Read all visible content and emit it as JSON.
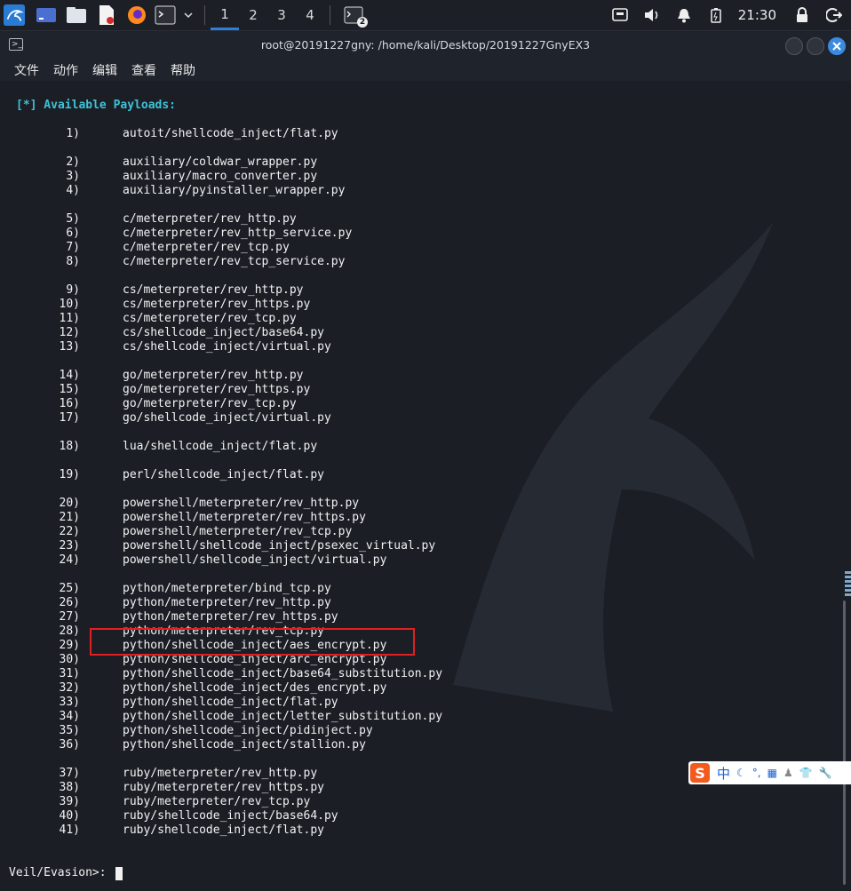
{
  "taskbar": {
    "workspaces": [
      "1",
      "2",
      "3",
      "4"
    ],
    "active_workspace": 0,
    "terminal_badge": "2",
    "clock": "21:30"
  },
  "window": {
    "title": "root@20191227gny: /home/kali/Desktop/20191227GnyEX3"
  },
  "menu": [
    "文件",
    "动作",
    "编辑",
    "查看",
    "帮助"
  ],
  "terminal": {
    "header": "[*] Available Payloads:",
    "payloads": [
      {
        "n": "1)",
        "p": "autoit/shellcode_inject/flat.py"
      },
      {
        "n": "2)",
        "p": "auxiliary/coldwar_wrapper.py"
      },
      {
        "n": "3)",
        "p": "auxiliary/macro_converter.py"
      },
      {
        "n": "4)",
        "p": "auxiliary/pyinstaller_wrapper.py"
      },
      {
        "n": "5)",
        "p": "c/meterpreter/rev_http.py"
      },
      {
        "n": "6)",
        "p": "c/meterpreter/rev_http_service.py"
      },
      {
        "n": "7)",
        "p": "c/meterpreter/rev_tcp.py"
      },
      {
        "n": "8)",
        "p": "c/meterpreter/rev_tcp_service.py"
      },
      {
        "n": "9)",
        "p": "cs/meterpreter/rev_http.py"
      },
      {
        "n": "10)",
        "p": "cs/meterpreter/rev_https.py"
      },
      {
        "n": "11)",
        "p": "cs/meterpreter/rev_tcp.py"
      },
      {
        "n": "12)",
        "p": "cs/shellcode_inject/base64.py"
      },
      {
        "n": "13)",
        "p": "cs/shellcode_inject/virtual.py"
      },
      {
        "n": "14)",
        "p": "go/meterpreter/rev_http.py"
      },
      {
        "n": "15)",
        "p": "go/meterpreter/rev_https.py"
      },
      {
        "n": "16)",
        "p": "go/meterpreter/rev_tcp.py"
      },
      {
        "n": "17)",
        "p": "go/shellcode_inject/virtual.py"
      },
      {
        "n": "18)",
        "p": "lua/shellcode_inject/flat.py"
      },
      {
        "n": "19)",
        "p": "perl/shellcode_inject/flat.py"
      },
      {
        "n": "20)",
        "p": "powershell/meterpreter/rev_http.py"
      },
      {
        "n": "21)",
        "p": "powershell/meterpreter/rev_https.py"
      },
      {
        "n": "22)",
        "p": "powershell/meterpreter/rev_tcp.py"
      },
      {
        "n": "23)",
        "p": "powershell/shellcode_inject/psexec_virtual.py"
      },
      {
        "n": "24)",
        "p": "powershell/shellcode_inject/virtual.py"
      },
      {
        "n": "25)",
        "p": "python/meterpreter/bind_tcp.py"
      },
      {
        "n": "26)",
        "p": "python/meterpreter/rev_http.py"
      },
      {
        "n": "27)",
        "p": "python/meterpreter/rev_https.py"
      },
      {
        "n": "28)",
        "p": "python/meterpreter/rev_tcp.py"
      },
      {
        "n": "29)",
        "p": "python/shellcode_inject/aes_encrypt.py"
      },
      {
        "n": "30)",
        "p": "python/shellcode_inject/arc_encrypt.py"
      },
      {
        "n": "31)",
        "p": "python/shellcode_inject/base64_substitution.py"
      },
      {
        "n": "32)",
        "p": "python/shellcode_inject/des_encrypt.py"
      },
      {
        "n": "33)",
        "p": "python/shellcode_inject/flat.py"
      },
      {
        "n": "34)",
        "p": "python/shellcode_inject/letter_substitution.py"
      },
      {
        "n": "35)",
        "p": "python/shellcode_inject/pidinject.py"
      },
      {
        "n": "36)",
        "p": "python/shellcode_inject/stallion.py"
      },
      {
        "n": "37)",
        "p": "ruby/meterpreter/rev_http.py"
      },
      {
        "n": "38)",
        "p": "ruby/meterpreter/rev_https.py"
      },
      {
        "n": "39)",
        "p": "ruby/meterpreter/rev_tcp.py"
      },
      {
        "n": "40)",
        "p": "ruby/shellcode_inject/base64.py"
      },
      {
        "n": "41)",
        "p": "ruby/shellcode_inject/flat.py"
      }
    ],
    "highlighted": "29)",
    "prompt": "Veil/Evasion>: "
  },
  "ime": {
    "logo": "S",
    "mode": "中"
  }
}
